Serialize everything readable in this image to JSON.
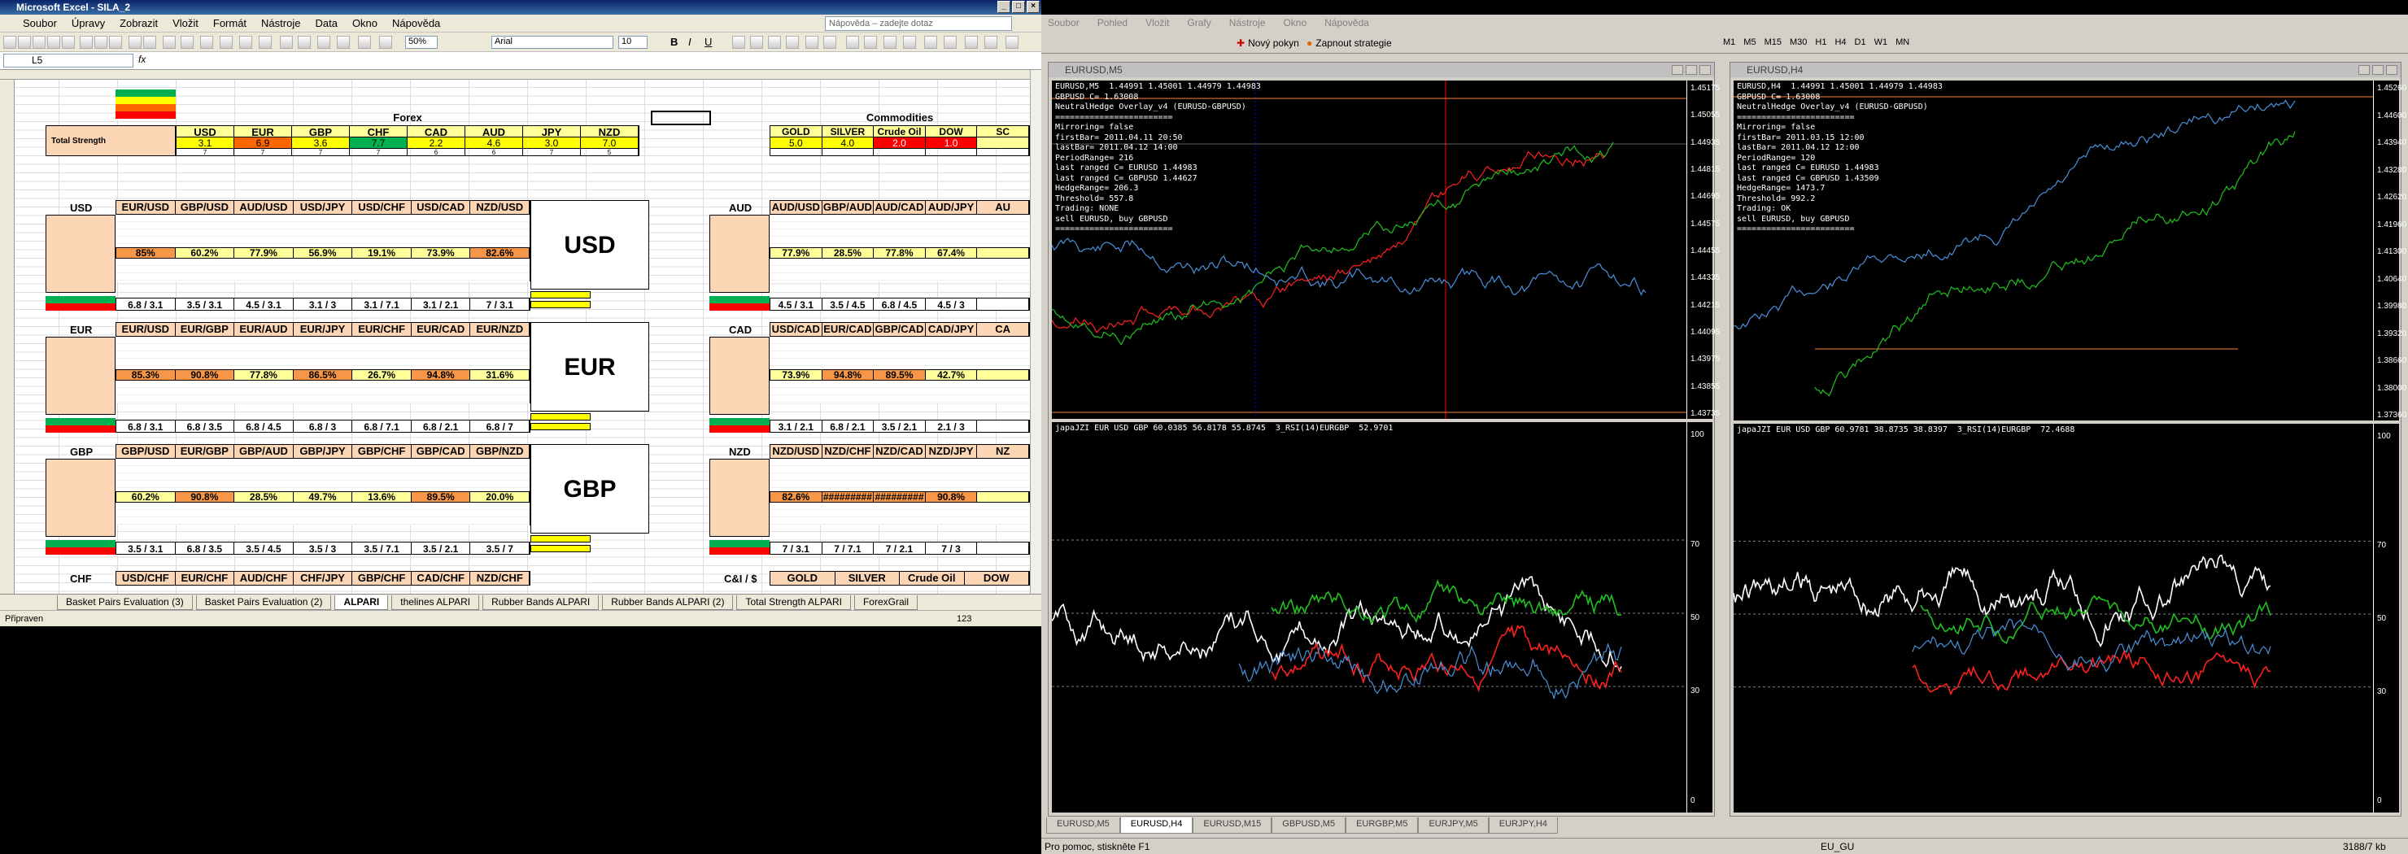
{
  "excel": {
    "title": "Microsoft Excel - SILA_2",
    "menu": [
      "Soubor",
      "Úpravy",
      "Zobrazit",
      "Vložit",
      "Formát",
      "Nástroje",
      "Data",
      "Okno",
      "Nápověda"
    ],
    "help_placeholder": "Nápověda – zadejte dotaz",
    "zoom": "50%",
    "font": "Arial",
    "font_size": "10",
    "name_box": "L5",
    "fx": "fx",
    "forex_label": "Forex",
    "commodities_label": "Commodities",
    "total_strength_label": "Total Strength",
    "forex_currencies": [
      "USD",
      "EUR",
      "GBP",
      "CHF",
      "CAD",
      "AUD",
      "JPY",
      "NZD"
    ],
    "forex_values": [
      "3.1",
      "6.9",
      "3.6",
      "7.7",
      "2.2",
      "4.6",
      "3.0",
      "7.0"
    ],
    "forex_counts": [
      "7",
      "7",
      "7",
      "7",
      "6",
      "6",
      "7",
      "5"
    ],
    "commodities": [
      "GOLD",
      "SILVER",
      "Crude Oil",
      "DOW",
      "SC"
    ],
    "commodity_values": [
      "5.0",
      "4.0",
      "2.0",
      "1.0",
      ""
    ],
    "blocks": [
      {
        "name": "USD",
        "big": "USD",
        "pairs": [
          "EUR/USD",
          "GBP/USD",
          "AUD/USD",
          "USD/JPY",
          "USD/CHF",
          "USD/CAD",
          "NZD/USD"
        ],
        "pct": [
          "85%",
          "60.2%",
          "77.9%",
          "56.9%",
          "19.1%",
          "73.9%",
          "82.6%"
        ],
        "ratios": [
          "6.8 / 3.1",
          "3.5 / 3.1",
          "4.5 / 3.1",
          "3.1 / 3",
          "3.1 / 7.1",
          "3.1 / 2.1",
          "7 / 3.1"
        ]
      },
      {
        "name": "EUR",
        "big": "EUR",
        "pairs": [
          "EUR/USD",
          "EUR/GBP",
          "EUR/AUD",
          "EUR/JPY",
          "EUR/CHF",
          "EUR/CAD",
          "EUR/NZD"
        ],
        "pct": [
          "85.3%",
          "90.8%",
          "77.8%",
          "86.5%",
          "26.7%",
          "94.8%",
          "31.6%"
        ],
        "ratios": [
          "6.8 / 3.1",
          "6.8 / 3.5",
          "6.8 / 4.5",
          "6.8 / 3",
          "6.8 / 7.1",
          "6.8 / 2.1",
          "6.8 / 7"
        ]
      },
      {
        "name": "GBP",
        "big": "GBP",
        "pairs": [
          "GBP/USD",
          "EUR/GBP",
          "GBP/AUD",
          "GBP/JPY",
          "GBP/CHF",
          "GBP/CAD",
          "GBP/NZD"
        ],
        "pct": [
          "60.2%",
          "90.8%",
          "28.5%",
          "49.7%",
          "13.6%",
          "89.5%",
          "20.0%"
        ],
        "ratios": [
          "3.5 / 3.1",
          "6.8 / 3.5",
          "3.5 / 4.5",
          "3.5 / 3",
          "3.5 / 7.1",
          "3.5 / 2.1",
          "3.5 / 7"
        ]
      }
    ],
    "right_blocks": [
      {
        "name": "AUD",
        "pairs": [
          "AUD/USD",
          "GBP/AUD",
          "AUD/CAD",
          "AUD/JPY",
          "AU"
        ],
        "pct": [
          "77.9%",
          "28.5%",
          "77.8%",
          "67.4%",
          ""
        ],
        "ratios": [
          "4.5 / 3.1",
          "3.5 / 4.5",
          "6.8 / 4.5",
          "4.5 / 3",
          ""
        ]
      },
      {
        "name": "CAD",
        "pairs": [
          "USD/CAD",
          "EUR/CAD",
          "GBP/CAD",
          "CAD/JPY",
          "CA"
        ],
        "pct": [
          "73.9%",
          "94.8%",
          "89.5%",
          "42.7%",
          ""
        ],
        "ratios": [
          "3.1 / 2.1",
          "6.8 / 2.1",
          "3.5 / 2.1",
          "2.1 / 3",
          ""
        ]
      },
      {
        "name": "NZD",
        "pairs": [
          "NZD/USD",
          "NZD/CHF",
          "NZD/CAD",
          "NZD/JPY",
          "NZ"
        ],
        "pct": [
          "82.6%",
          "#########",
          "#########",
          "90.8%",
          ""
        ],
        "ratios": [
          "7 / 3.1",
          "7 / 7.1",
          "7 / 2.1",
          "7 / 3",
          ""
        ]
      }
    ],
    "chf_row": [
      "USD/CHF",
      "EUR/CHF",
      "AUD/CHF",
      "CHF/JPY",
      "GBP/CHF",
      "CAD/CHF",
      "NZD/CHF"
    ],
    "cs_label": "C&I / $",
    "cs_row": [
      "GOLD",
      "SILVER",
      "Crude Oil",
      "DOW"
    ],
    "sheet_tabs": [
      "Basket Pairs Evaluation (3)",
      "Basket Pairs Evaluation (2)",
      "ALPARI",
      "thelines ALPARI",
      "Rubber Bands ALPARI",
      "Rubber Bands ALPARI (2)",
      "Total Strength ALPARI",
      "ForexGrail"
    ],
    "active_tab": "ALPARI",
    "status": "Připraven",
    "status_num": "123"
  },
  "mt": {
    "menu": [
      "Soubor",
      "Pohled",
      "Vložit",
      "Grafy",
      "Nástroje",
      "Okno",
      "Nápověda"
    ],
    "new_order": "Nový pokyn",
    "start_strategy": "Zapnout strategie",
    "timeframes": [
      "M1",
      "M5",
      "M15",
      "M30",
      "H1",
      "H4",
      "D1",
      "W1",
      "MN"
    ],
    "chart1": {
      "title": "EURUSD,M5",
      "info": "EURUSD,M5  1.44991 1.45001 1.44979 1.44983\nGBPUSD C= 1.63008\nNeutralHedge Overlay_v4 (EURUSD-GBPUSD)\n========================\nMirroring= false\nfirstBar= 2011.04.11 20:50\nlastBar= 2011.04.12 14:00\nPeriodRange= 216\nlast ranged C= EURUSD 1.44983\nlast ranged C= GBPUSD 1.44627\nHedgeRange= 206.3\nThreshold= 557.8\nTrading: NONE\nsell EURUSD, buy GBPUSD\n========================",
      "prices": [
        "1.45175",
        "1.45055",
        "1.44935",
        "1.44815",
        "1.44695",
        "1.44575",
        "1.44455",
        "1.44335",
        "1.44215",
        "1.44095",
        "1.43975",
        "1.43855",
        "1.43735"
      ],
      "ind_label": "japaJZI EUR USD GBP 60.0385 56.8178 55.8745  3_RSI(14)EURGBP  52.9701",
      "ind_scale": [
        "100",
        "70",
        "50",
        "30",
        "0"
      ]
    },
    "chart2": {
      "title": "EURUSD,H4",
      "info": "EURUSD,H4  1.44991 1.45001 1.44979 1.44983\nGBPUSD C= 1.63008\nNeutralHedge Overlay_v4 (EURUSD-GBPUSD)\n========================\nMirroring= false\nfirstBar= 2011.03.15 12:00\nlastBar= 2011.04.12 12:00\nPeriodRange= 120\nlast ranged C= EURUSD 1.44983\nlast ranged C= GBPUSD 1.43509\nHedgeRange= 1473.7\nThreshold= 992.2\nTrading: OK\nsell EURUSD, buy GBPUSD\n========================",
      "prices": [
        "1.45260",
        "1.44600",
        "1.43940",
        "1.43280",
        "1.42620",
        "1.41960",
        "1.41300",
        "1.40640",
        "1.39980",
        "1.39320",
        "1.38660",
        "1.38000",
        "1.37360"
      ],
      "ind_label": "japaJZI EUR USD GBP 60.9781 38.8735 38.8397  3_RSI(14)EURGBP  72.4688",
      "ind_scale": [
        "100",
        "70",
        "50",
        "30",
        "0"
      ]
    },
    "tabs": [
      "EURUSD,M5",
      "EURUSD,H4",
      "EURUSD,M15",
      "GBPUSD,M5",
      "EURGBP,M5",
      "EURJPY,M5",
      "EURJPY,H4"
    ],
    "active_tab": "EURUSD,H4",
    "status_left": "Pro pomoc, stiskněte F1",
    "status_profile": "EU_GU",
    "status_right": "3188/7 kb"
  }
}
